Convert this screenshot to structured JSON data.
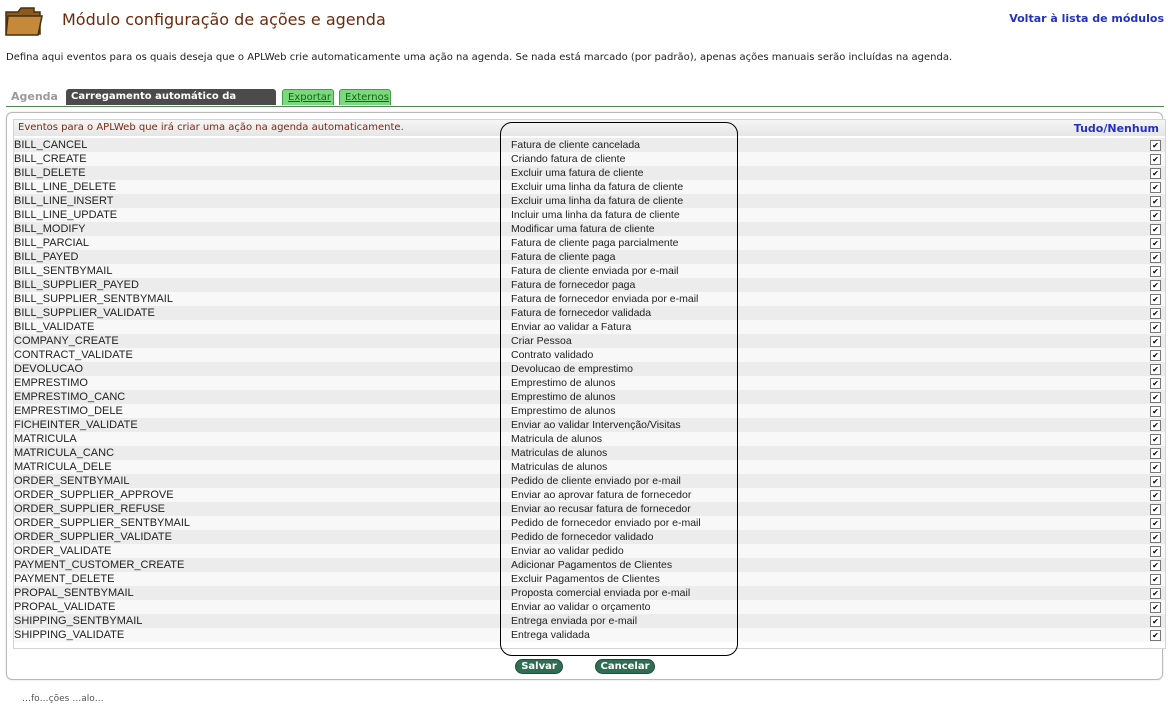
{
  "header": {
    "title": "Módulo configuração de ações e agenda",
    "back_link": "Voltar à lista de módulos"
  },
  "description": "Defina aqui eventos para os quais deseja que o APLWeb crie automaticamente uma ação na agenda. Se nada está marcado (por padrão), apenas ações manuais serão incluídas na agenda.",
  "tabs": [
    {
      "label": "Agenda"
    },
    {
      "label": "Carregamento automático da ordem do dia"
    },
    {
      "label": "Exportar"
    },
    {
      "label": "Externos"
    }
  ],
  "panel": {
    "title": "Eventos para o APLWeb que irá criar uma ação na agenda automaticamente.",
    "all_label": "Tudo",
    "separator": "/",
    "none_label": "Nenhum"
  },
  "events": [
    {
      "code": "BILL_CANCEL",
      "description": "Fatura de cliente cancelada",
      "checked": true
    },
    {
      "code": "BILL_CREATE",
      "description": "Criando fatura de cliente",
      "checked": true
    },
    {
      "code": "BILL_DELETE",
      "description": "Excluir uma fatura de cliente",
      "checked": true
    },
    {
      "code": "BILL_LINE_DELETE",
      "description": "Excluir uma linha da fatura de cliente",
      "checked": true
    },
    {
      "code": "BILL_LINE_INSERT",
      "description": "Excluir uma linha da fatura de cliente",
      "checked": true
    },
    {
      "code": "BILL_LINE_UPDATE",
      "description": "Incluir uma linha da fatura de cliente",
      "checked": true
    },
    {
      "code": "BILL_MODIFY",
      "description": "Modificar uma fatura de cliente",
      "checked": true
    },
    {
      "code": "BILL_PARCIAL",
      "description": "Fatura de cliente paga parcialmente",
      "checked": true
    },
    {
      "code": "BILL_PAYED",
      "description": "Fatura de cliente paga",
      "checked": true
    },
    {
      "code": "BILL_SENTBYMAIL",
      "description": "Fatura de cliente enviada por e-mail",
      "checked": true
    },
    {
      "code": "BILL_SUPPLIER_PAYED",
      "description": "Fatura de fornecedor paga",
      "checked": true
    },
    {
      "code": "BILL_SUPPLIER_SENTBYMAIL",
      "description": "Fatura de fornecedor enviada por e-mail",
      "checked": true
    },
    {
      "code": "BILL_SUPPLIER_VALIDATE",
      "description": "Fatura de fornecedor validada",
      "checked": true
    },
    {
      "code": "BILL_VALIDATE",
      "description": "Enviar ao validar a Fatura",
      "checked": true
    },
    {
      "code": "COMPANY_CREATE",
      "description": "Criar Pessoa",
      "checked": true
    },
    {
      "code": "CONTRACT_VALIDATE",
      "description": "Contrato validado",
      "checked": true
    },
    {
      "code": "DEVOLUCAO",
      "description": "Devolucao de emprestimo",
      "checked": true
    },
    {
      "code": "EMPRESTIMO",
      "description": "Emprestimo de alunos",
      "checked": true
    },
    {
      "code": "EMPRESTIMO_CANC",
      "description": "Emprestimo de alunos",
      "checked": true
    },
    {
      "code": "EMPRESTIMO_DELE",
      "description": "Emprestimo de alunos",
      "checked": true
    },
    {
      "code": "FICHEINTER_VALIDATE",
      "description": "Enviar ao validar Intervenção/Visitas",
      "checked": true
    },
    {
      "code": "MATRICULA",
      "description": "Matricula de alunos",
      "checked": true
    },
    {
      "code": "MATRICULA_CANC",
      "description": "Matriculas de alunos",
      "checked": true
    },
    {
      "code": "MATRICULA_DELE",
      "description": "Matriculas de alunos",
      "checked": true
    },
    {
      "code": "ORDER_SENTBYMAIL",
      "description": "Pedido de cliente enviado por e-mail",
      "checked": true
    },
    {
      "code": "ORDER_SUPPLIER_APPROVE",
      "description": "Enviar ao aprovar fatura de fornecedor",
      "checked": true
    },
    {
      "code": "ORDER_SUPPLIER_REFUSE",
      "description": "Enviar ao recusar fatura de fornecedor",
      "checked": true
    },
    {
      "code": "ORDER_SUPPLIER_SENTBYMAIL",
      "description": "Pedido de fornecedor enviado por e-mail",
      "checked": true
    },
    {
      "code": "ORDER_SUPPLIER_VALIDATE",
      "description": "Pedido de fornecedor validado",
      "checked": true
    },
    {
      "code": "ORDER_VALIDATE",
      "description": "Enviar ao validar pedido",
      "checked": true
    },
    {
      "code": "PAYMENT_CUSTOMER_CREATE",
      "description": "Adicionar Pagamentos de Clientes",
      "checked": true
    },
    {
      "code": "PAYMENT_DELETE",
      "description": "Excluir Pagamentos de Clientes",
      "checked": true
    },
    {
      "code": "PROPAL_SENTBYMAIL",
      "description": "Proposta comercial enviada por e-mail",
      "checked": true
    },
    {
      "code": "PROPAL_VALIDATE",
      "description": "Enviar ao validar o orçamento",
      "checked": true
    },
    {
      "code": "SHIPPING_SENTBYMAIL",
      "description": "Entrega enviada por e-mail",
      "checked": true
    },
    {
      "code": "SHIPPING_VALIDATE",
      "description": "Entrega validada",
      "checked": true
    }
  ],
  "buttons": {
    "save": "Salvar",
    "cancel": "Cancelar"
  },
  "footer_text": "…fo…ções …alo…",
  "colors": {
    "title": "#6b2a0e",
    "link": "#2233bb",
    "button": "#2f6e52",
    "tab_green": "#7cd87c"
  },
  "icons": {
    "module": "folder-icon",
    "checkbox": "check-icon"
  }
}
